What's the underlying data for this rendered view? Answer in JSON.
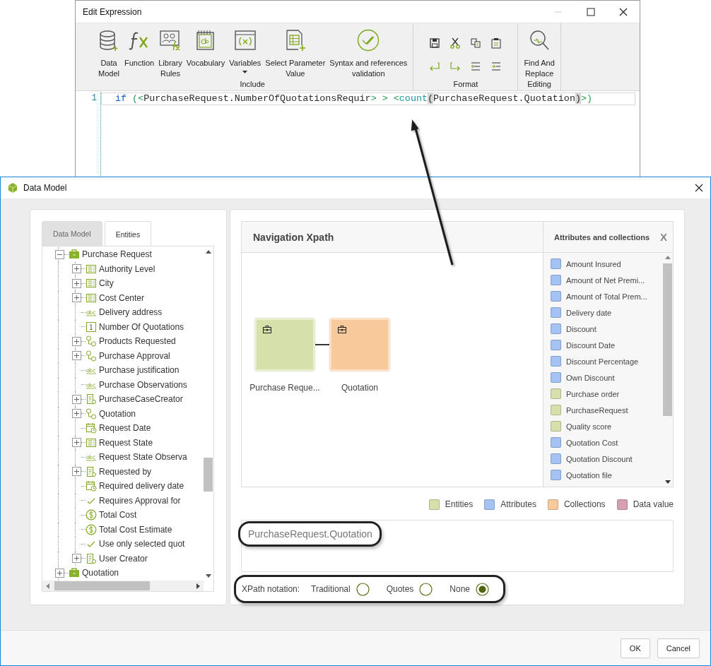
{
  "expression_window": {
    "title": "Edit Expression",
    "ribbon": [
      {
        "label": "Include",
        "kind": "large",
        "buttons": [
          {
            "lines": [
              "Data",
              "Model"
            ],
            "kind": "database",
            "menu": false
          },
          {
            "lines": [
              "Function"
            ],
            "kind": "function",
            "menu": false
          },
          {
            "lines": [
              "Library",
              "Rules"
            ],
            "kind": "library",
            "menu": false
          },
          {
            "lines": [
              "Vocabulary"
            ],
            "kind": "vocabulary",
            "menu": false
          },
          {
            "lines": [
              "Variables"
            ],
            "kind": "variables",
            "menu": true
          },
          {
            "lines": [
              "Select Parameter",
              "Value"
            ],
            "kind": "parameter",
            "menu": false
          },
          {
            "lines": [
              "Syntax and references",
              "validation"
            ],
            "kind": "validation",
            "menu": false
          }
        ]
      },
      {
        "label": "Format",
        "kind": "small"
      },
      {
        "label": "Editing",
        "kind": "large",
        "buttons": [
          {
            "lines": [
              "Find And",
              "Replace"
            ],
            "kind": "find",
            "menu": false
          }
        ]
      }
    ],
    "editor": {
      "lines": [
        {
          "number": "1",
          "tokens": [
            {
              "text": "if",
              "kind": "keyword"
            },
            {
              "text": " (<",
              "kind": "operator"
            },
            {
              "text": "PurchaseRequest.NumberOfQuotationsRequir",
              "kind": "identifier"
            },
            {
              "text": "> > <",
              "kind": "operator"
            },
            {
              "text": "count",
              "kind": "function"
            },
            {
              "text": "(",
              "kind": "match"
            },
            {
              "text": "PurchaseRequest.Quotation",
              "kind": "identifier"
            },
            {
              "text": ")",
              "kind": "match"
            },
            {
              "text": ">)",
              "kind": "operator"
            }
          ]
        }
      ]
    }
  },
  "data_model_window": {
    "title": "Data Model",
    "tabs": [
      {
        "label": "Data Model",
        "selected": false
      },
      {
        "label": "Entities",
        "selected": true
      }
    ],
    "tree": [
      {
        "label": "Purchase Request",
        "kind": "entity",
        "expanded": true,
        "children": [
          {
            "label": "Authority Level",
            "kind": "table",
            "expanded": false
          },
          {
            "label": "City",
            "kind": "table",
            "expanded": false
          },
          {
            "label": "Cost Center",
            "kind": "table",
            "expanded": false
          },
          {
            "label": "Delivery address",
            "kind": "text"
          },
          {
            "label": "Number Of Quotations",
            "kind": "number"
          },
          {
            "label": "Products Requested",
            "kind": "relation",
            "expanded": false
          },
          {
            "label": "Purchase Approval",
            "kind": "relation",
            "expanded": false
          },
          {
            "label": "Purchase justification",
            "kind": "text"
          },
          {
            "label": "Purchase Observations",
            "kind": "text"
          },
          {
            "label": "PurchaseCaseCreator",
            "kind": "user",
            "expanded": false
          },
          {
            "label": "Quotation",
            "kind": "relation",
            "expanded": false
          },
          {
            "label": "Request Date",
            "kind": "date"
          },
          {
            "label": "Request State",
            "kind": "table",
            "expanded": false
          },
          {
            "label": "Request State Observa",
            "kind": "text"
          },
          {
            "label": "Requested by",
            "kind": "user",
            "expanded": false
          },
          {
            "label": "Required delivery date",
            "kind": "date"
          },
          {
            "label": "Requires Approval for",
            "kind": "check"
          },
          {
            "label": "Total Cost",
            "kind": "money"
          },
          {
            "label": "Total Cost Estimate",
            "kind": "money"
          },
          {
            "label": "Use only selected quot",
            "kind": "check"
          },
          {
            "label": "User Creator",
            "kind": "user",
            "expanded": false
          }
        ]
      },
      {
        "label": "Quotation",
        "kind": "entity",
        "expanded": false
      }
    ],
    "navigation": {
      "title": "Navigation Xpath",
      "nodes": [
        {
          "label": "Purchase Reque...",
          "color": "#d5e0ab"
        },
        {
          "label": "Quotation",
          "color": "#f7c99b"
        }
      ]
    },
    "attributes": {
      "title": "Attributes and collections",
      "close": "X",
      "items": [
        {
          "label": "Amount Insured",
          "color": "#a4c2f4"
        },
        {
          "label": "Amount of Net Premi...",
          "color": "#a4c2f4"
        },
        {
          "label": "Amount of Total Prem...",
          "color": "#a4c2f4"
        },
        {
          "label": "Delivery date",
          "color": "#a4c2f4"
        },
        {
          "label": "Discount",
          "color": "#a4c2f4"
        },
        {
          "label": "Discount Date",
          "color": "#a4c2f4"
        },
        {
          "label": "Discount Percentage",
          "color": "#a4c2f4"
        },
        {
          "label": "Own Discount",
          "color": "#a4c2f4"
        },
        {
          "label": "Purchase order",
          "color": "#d5e0ab"
        },
        {
          "label": "PurchaseRequest",
          "color": "#d5e0ab"
        },
        {
          "label": "Quality score",
          "color": "#d5e0ab"
        },
        {
          "label": "Quotation Cost",
          "color": "#a4c2f4"
        },
        {
          "label": "Quotation Discount",
          "color": "#a4c2f4"
        },
        {
          "label": "Quotation file",
          "color": "#a4c2f4"
        }
      ]
    },
    "legend": [
      {
        "label": "Entities",
        "color": "#d5e0ab"
      },
      {
        "label": "Attributes",
        "color": "#a4c2f4"
      },
      {
        "label": "Collections",
        "color": "#f7c99b"
      },
      {
        "label": "Data value",
        "color": "#d5a0b0"
      }
    ],
    "path": "PurchaseRequest.Quotation",
    "notation": {
      "label": "XPath notation:",
      "options": [
        {
          "label": "Traditional",
          "selected": false
        },
        {
          "label": "Quotes",
          "selected": false
        },
        {
          "label": "None",
          "selected": true
        }
      ]
    },
    "buttons": [
      "OK",
      "Cancel"
    ]
  }
}
